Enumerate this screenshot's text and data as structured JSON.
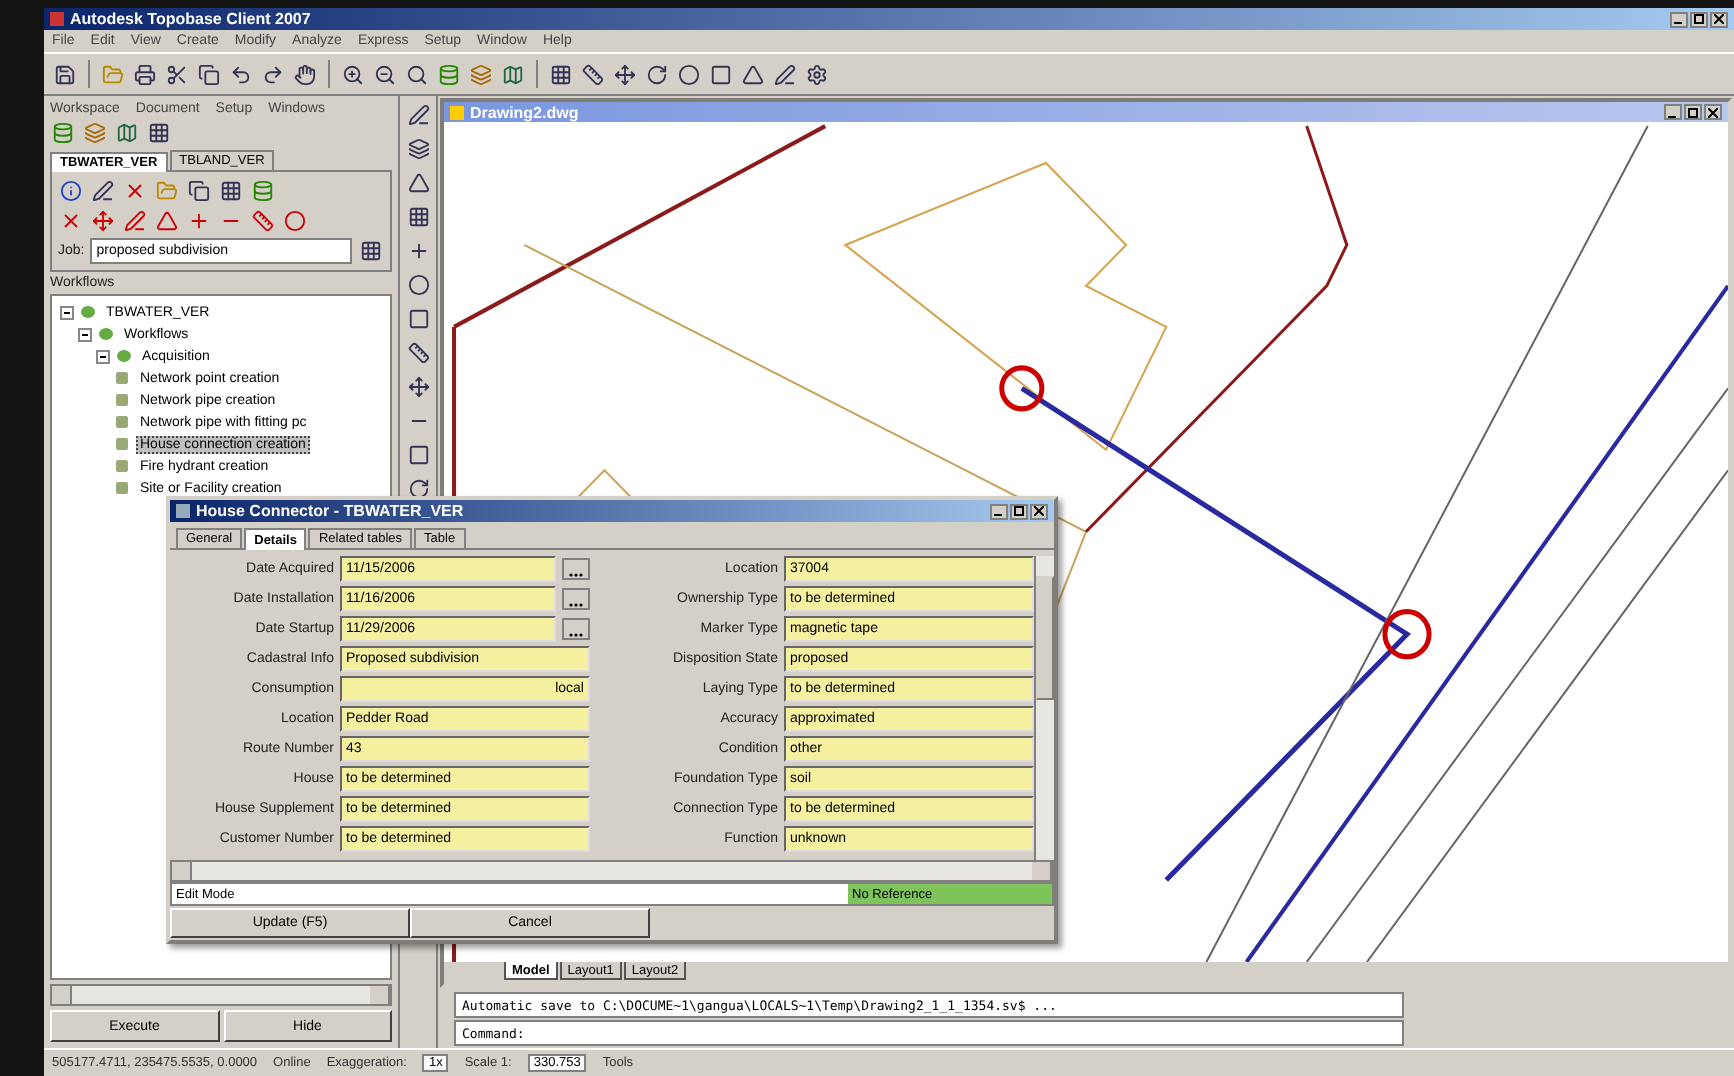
{
  "window": {
    "title": "Autodesk Topobase Client 2007"
  },
  "menu": [
    "File",
    "Edit",
    "View",
    "Create",
    "Modify",
    "Analyze",
    "Express",
    "Setup",
    "Window",
    "Help"
  ],
  "left_panel": {
    "menu": [
      "Workspace",
      "Document",
      "Setup",
      "Windows"
    ],
    "tabs": [
      {
        "label": "TBWATER_VER",
        "selected": true
      },
      {
        "label": "TBLAND_VER",
        "selected": false
      }
    ],
    "job": {
      "label": "Job:",
      "value": "proposed subdivision"
    },
    "workflows_label": "Workflows",
    "tree": [
      {
        "label": "TBWATER_VER",
        "expanded": true,
        "children": [
          {
            "label": "Workflows",
            "expanded": true,
            "children": [
              {
                "label": "Acquisition",
                "expanded": true,
                "children": [
                  {
                    "label": "Network point creation",
                    "selected": false
                  },
                  {
                    "label": "Network pipe creation",
                    "selected": false
                  },
                  {
                    "label": "Network pipe with fitting pc",
                    "selected": false
                  },
                  {
                    "label": "House connection creation",
                    "selected": true
                  },
                  {
                    "label": "Fire hydrant creation",
                    "selected": false
                  },
                  {
                    "label": "Site or Facility creation",
                    "selected": false
                  }
                ]
              }
            ]
          }
        ]
      }
    ],
    "buttons": [
      "Execute",
      "Hide"
    ]
  },
  "drawing": {
    "title": "Drawing2.dwg",
    "layout_tabs": [
      {
        "label": "Model",
        "selected": true
      },
      {
        "label": "Layout1",
        "selected": false
      },
      {
        "label": "Layout2",
        "selected": false
      }
    ]
  },
  "command_line": {
    "history": "Automatic save to C:\\DOCUME~1\\gangua\\LOCALS~1\\Temp\\Drawing2_1_1_1354.sv$ ...",
    "prompt": "Command:"
  },
  "dialog": {
    "title": "House Connector - TBWATER_VER",
    "tabs": [
      {
        "label": "General",
        "selected": false
      },
      {
        "label": "Details",
        "selected": true
      },
      {
        "label": "Related tables",
        "selected": false
      },
      {
        "label": "Table",
        "selected": false
      }
    ],
    "left_fields": [
      {
        "label": "Date Acquired",
        "value": "11/15/2006",
        "kind": "date"
      },
      {
        "label": "Date Installation",
        "value": "11/16/2006",
        "kind": "date"
      },
      {
        "label": "Date Startup",
        "value": "11/29/2006",
        "kind": "date"
      },
      {
        "label": "Cadastral Info",
        "value": "Proposed subdivision",
        "kind": "text"
      },
      {
        "label": "Consumption",
        "unit": "local",
        "kind": "unit"
      },
      {
        "label": "Location",
        "value": "Pedder Road",
        "kind": "text"
      },
      {
        "label": "Route Number",
        "value": "43",
        "kind": "text"
      },
      {
        "label": "House",
        "value": "to be determined",
        "kind": "text"
      },
      {
        "label": "House Supplement",
        "value": "to be determined",
        "kind": "text"
      },
      {
        "label": "Customer Number",
        "value": "to be determined",
        "kind": "text"
      }
    ],
    "right_fields": [
      {
        "label": "Location",
        "value": "37004",
        "kind": "text"
      },
      {
        "label": "Ownership Type",
        "value": "to be determined",
        "kind": "text"
      },
      {
        "label": "Marker Type",
        "value": "magnetic tape",
        "kind": "text"
      },
      {
        "label": "Disposition State",
        "value": "proposed",
        "kind": "text"
      },
      {
        "label": "Laying Type",
        "value": "to be determined",
        "kind": "text"
      },
      {
        "label": "Accuracy",
        "value": "approximated",
        "kind": "text"
      },
      {
        "label": "Condition",
        "value": "other",
        "kind": "text"
      },
      {
        "label": "Foundation Type",
        "value": "soil",
        "kind": "text"
      },
      {
        "label": "Connection Type",
        "value": "to be determined",
        "kind": "text"
      },
      {
        "label": "Function",
        "value": "unknown",
        "kind": "text"
      }
    ],
    "mode": "Edit Mode",
    "reference": "No Reference",
    "buttons": [
      "Update (F5)",
      "Cancel"
    ]
  },
  "status_bar": {
    "coordinates": "505177.4711, 235475.5535, 0.0000",
    "online": "Online",
    "exaggeration_label": "Exaggeration:",
    "exaggeration": "1x",
    "scale_label": "Scale 1:",
    "scale": "330.753",
    "tools": "Tools"
  }
}
